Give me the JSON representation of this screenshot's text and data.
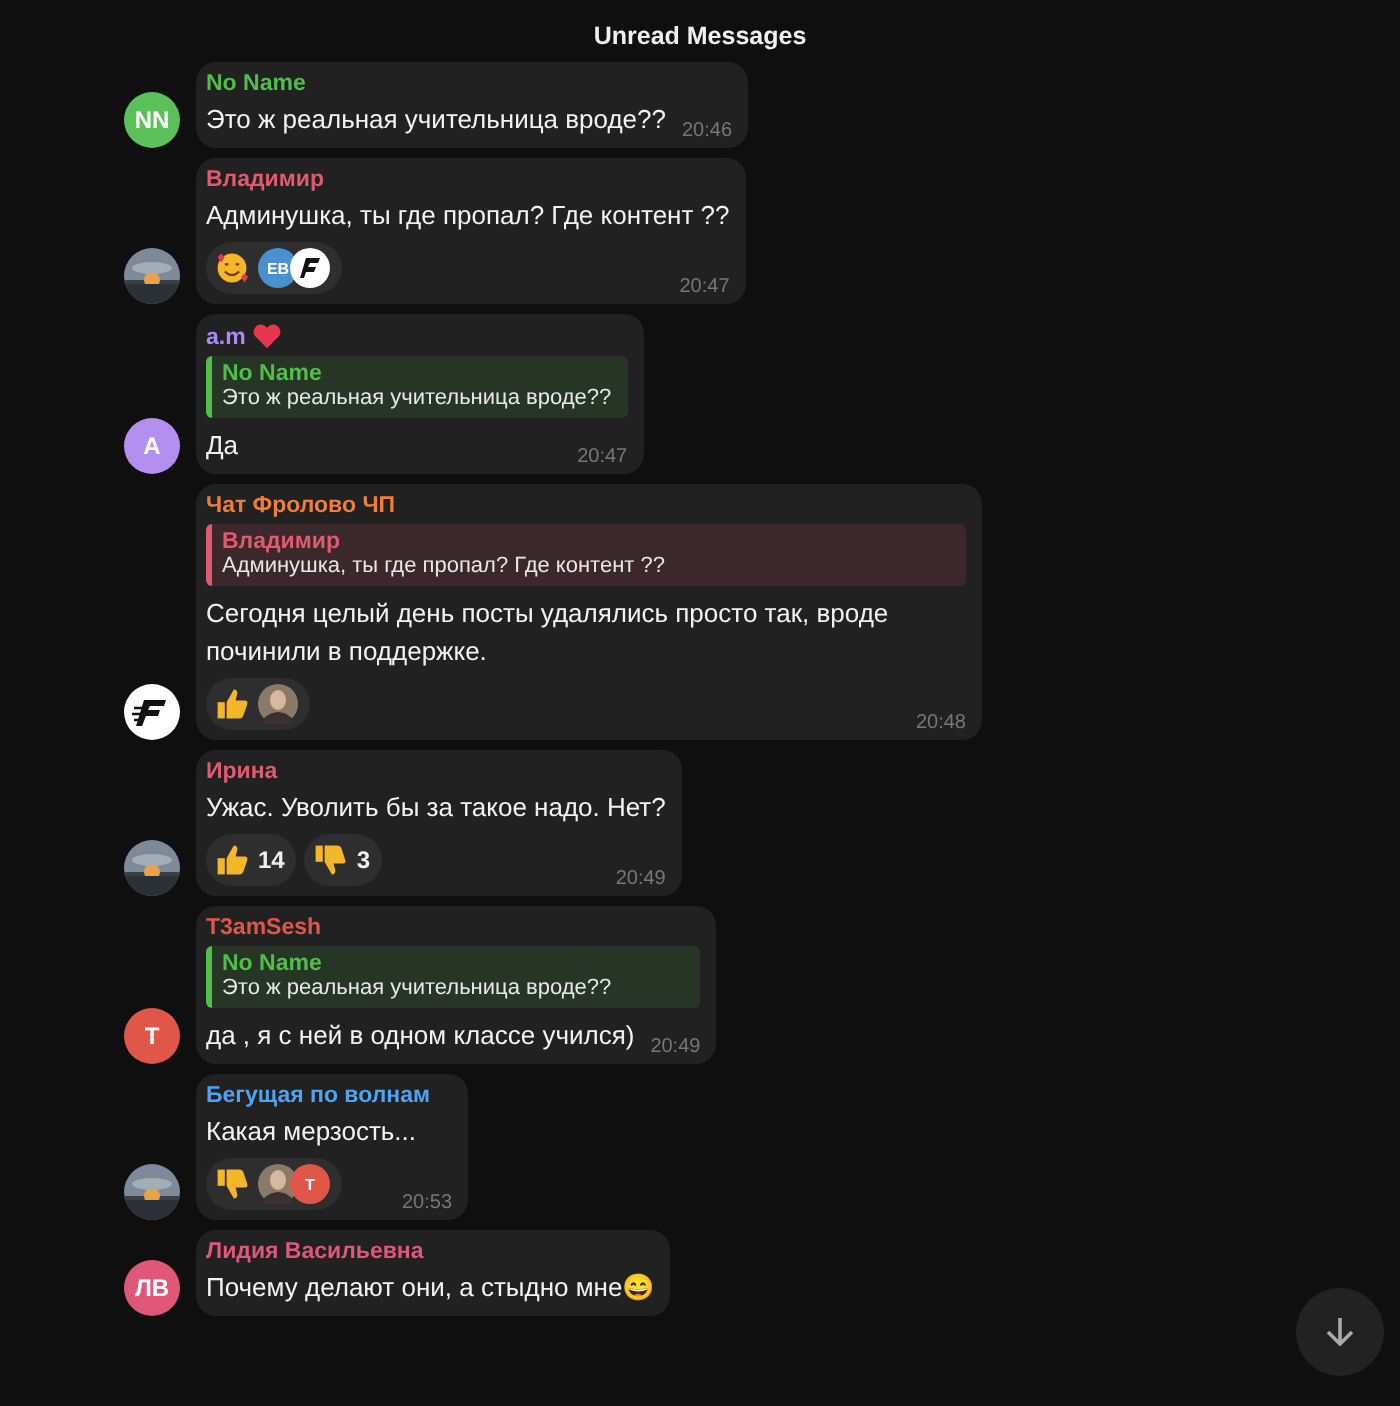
{
  "header": {
    "title": "Unread Messages"
  },
  "messages": [
    {
      "avatar": {
        "kind": "initials",
        "text": "NN",
        "color": "#5cc05a"
      },
      "author": "No Name",
      "color": "#4fbf4a",
      "text": "Это ж реальная учительница вроде??",
      "time": "20:46"
    },
    {
      "avatar": {
        "kind": "picture"
      },
      "author": "Владимир",
      "color": "#e05a70",
      "text": "Админушка, ты где пропал? Где контент ??",
      "reactions": [
        {
          "kind": "love",
          "reactors": [
            {
              "kind": "initials",
              "text": "EB",
              "color": "#4a90d0"
            },
            {
              "kind": "logo"
            }
          ]
        }
      ],
      "time": "20:47"
    },
    {
      "avatar": {
        "kind": "initials",
        "text": "A",
        "color": "#b38ff0"
      },
      "author": "a.m",
      "author_badge": true,
      "color": "#a98bf5",
      "reply": {
        "author": "No Name",
        "text": "Это ж реальная учительница вроде??",
        "color": "#4fbf4a"
      },
      "text": "Да",
      "time": "20:47"
    },
    {
      "avatar": {
        "kind": "logo"
      },
      "author": "Чат Фролово ЧП",
      "color": "#f07d3a",
      "reply": {
        "author": "Владимир",
        "text": "Админушка, ты где пропал? Где контент ??",
        "color": "#e05a70"
      },
      "text": "Сегодня целый день посты удалялись просто так, вроде починили в поддержке.",
      "reactions": [
        {
          "kind": "like",
          "reactors": [
            {
              "kind": "picture"
            }
          ]
        }
      ],
      "time": "20:48"
    },
    {
      "avatar": {
        "kind": "picture"
      },
      "author": "Ирина",
      "color": "#e05a70",
      "text": "Ужас. Уволить бы за такое надо. Нет?",
      "reactions": [
        {
          "kind": "like",
          "count": "14"
        },
        {
          "kind": "dislike",
          "count": "3"
        }
      ],
      "time": "20:49"
    },
    {
      "avatar": {
        "kind": "initials",
        "text": "T",
        "color": "#e0574a"
      },
      "author": "T3amSesh",
      "color": "#e0574a",
      "reply": {
        "author": "No Name",
        "text": "Это ж реальная учительница вроде??",
        "color": "#4fbf4a"
      },
      "text": "да , я с ней в одном классе учился)",
      "time": "20:49"
    },
    {
      "avatar": {
        "kind": "picture"
      },
      "author": "Бегущая по волнам",
      "color": "#4fa3f0",
      "text": "Какая мерзость...",
      "reactions": [
        {
          "kind": "dislike",
          "reactors": [
            {
              "kind": "picture"
            },
            {
              "kind": "initials",
              "text": "T",
              "color": "#e0574a"
            }
          ]
        }
      ],
      "time": "20:53"
    },
    {
      "avatar": {
        "kind": "initials",
        "text": "ЛВ",
        "color": "#e0577a"
      },
      "author": "Лидия Васильевна",
      "color": "#e0577a",
      "text": "Почему делают они, а стыдно мне😄"
    }
  ]
}
